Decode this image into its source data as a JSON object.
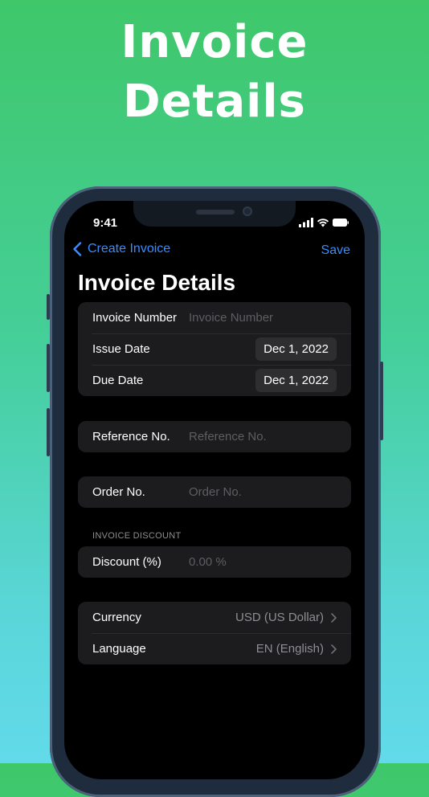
{
  "headline": {
    "line1": "Invoice",
    "line2": "Details"
  },
  "status_bar": {
    "time": "9:41",
    "icons": [
      "signal-icon",
      "wifi-icon",
      "battery-icon"
    ]
  },
  "nav": {
    "back_label": "Create Invoice",
    "save_label": "Save"
  },
  "page_title": "Invoice Details",
  "groups": {
    "main": {
      "invoice_number": {
        "label": "Invoice Number",
        "placeholder": "Invoice Number"
      },
      "issue_date": {
        "label": "Issue Date",
        "value": "Dec 1, 2022"
      },
      "due_date": {
        "label": "Due Date",
        "value": "Dec 1, 2022"
      }
    },
    "reference": {
      "label": "Reference No.",
      "placeholder": "Reference No."
    },
    "order": {
      "label": "Order No.",
      "placeholder": "Order No."
    },
    "discount": {
      "header": "INVOICE DISCOUNT",
      "label": "Discount (%)",
      "placeholder": "0.00 %"
    },
    "locale": {
      "currency": {
        "label": "Currency",
        "value": "USD (US Dollar)"
      },
      "language": {
        "label": "Language",
        "value": "EN (English)"
      }
    }
  },
  "colors": {
    "accent": "#3a8cff",
    "background_top": "#3fc76a",
    "background_bottom": "#62daea"
  }
}
